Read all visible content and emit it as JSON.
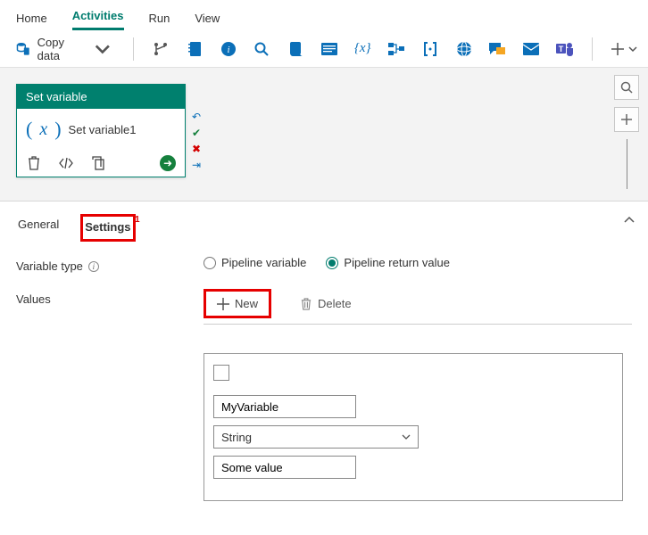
{
  "nav": {
    "tabs": [
      "Home",
      "Activities",
      "Run",
      "View"
    ],
    "active": 1
  },
  "toolbar": {
    "copy_label": "Copy data"
  },
  "canvas": {
    "node": {
      "title": "Set variable",
      "name": "Set variable1"
    }
  },
  "props": {
    "tabs": {
      "general": "General",
      "settings": "Settings",
      "settings_badge": "1"
    },
    "var_type_label": "Variable type",
    "radios": {
      "pipeline_var": "Pipeline variable",
      "pipeline_return": "Pipeline return value"
    },
    "values_label": "Values",
    "buttons": {
      "new": "New",
      "delete": "Delete"
    },
    "value_item": {
      "name": "MyVariable",
      "type": "String",
      "value": "Some value"
    }
  }
}
